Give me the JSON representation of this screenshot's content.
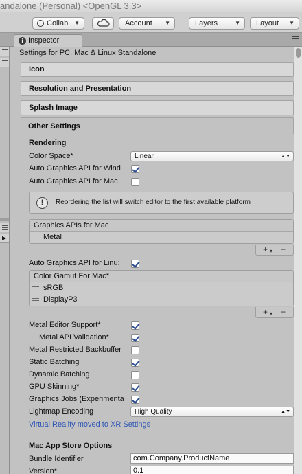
{
  "window": {
    "title": "andalone (Personal) <OpenGL 3.3>"
  },
  "toolbar": {
    "collab": "Collab",
    "account": "Account",
    "layers": "Layers",
    "layout": "Layout"
  },
  "tab": {
    "label": "Inspector"
  },
  "inspector": {
    "title": "Settings for PC, Mac & Linux Standalone",
    "sections": [
      "Icon",
      "Resolution and Presentation",
      "Splash Image"
    ],
    "other": {
      "header": "Other Settings",
      "rendering": "Rendering",
      "color_space_label": "Color Space*",
      "color_space_value": "Linear",
      "auto_api_windows": "Auto Graphics API  for Wind",
      "auto_api_windows_checked": true,
      "auto_api_mac": "Auto Graphics API  for Mac",
      "auto_api_mac_checked": false,
      "help_text": "Reordering the list will switch editor to the first available platform",
      "graphics_apis_header": "Graphics APIs for Mac",
      "graphics_apis": [
        "Metal"
      ],
      "auto_api_linux": "Auto Graphics API  for Linu:",
      "auto_api_linux_checked": true,
      "color_gamut_header": "Color Gamut For Mac*",
      "color_gamut": [
        "sRGB",
        "DisplayP3"
      ],
      "toggles": [
        {
          "label": "Metal Editor Support*",
          "checked": true,
          "indent": false
        },
        {
          "label": "Metal API Validation*",
          "checked": true,
          "indent": true
        },
        {
          "label": "Metal Restricted Backbuffer",
          "checked": false,
          "indent": false
        },
        {
          "label": "Static Batching",
          "checked": true,
          "indent": false
        },
        {
          "label": "Dynamic Batching",
          "checked": false,
          "indent": false
        },
        {
          "label": "GPU Skinning*",
          "checked": true,
          "indent": false
        },
        {
          "label": "Graphics Jobs (Experimenta",
          "checked": true,
          "indent": false
        }
      ],
      "lightmap_label": "Lightmap Encoding",
      "lightmap_value": "High Quality",
      "vr_link": "Virtual Reality moved to XR Settings",
      "mac_store_header": "Mac App Store Options",
      "bundle_id_label": "Bundle Identifier",
      "bundle_id_value": "com.Company.ProductName",
      "version_label": "Version*",
      "version_value": "0.1"
    }
  }
}
